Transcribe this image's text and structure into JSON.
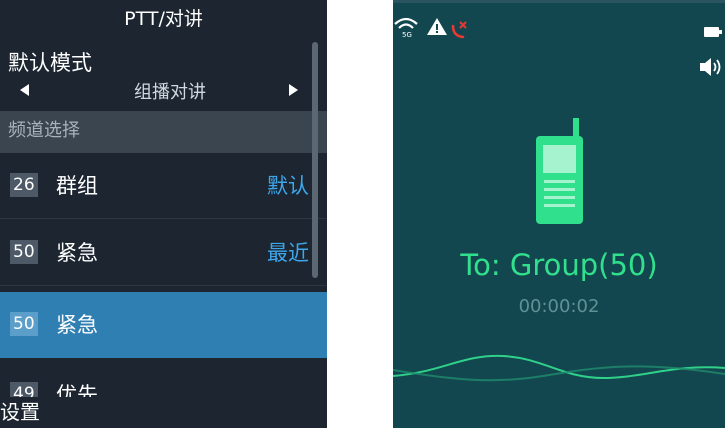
{
  "left_screen": {
    "title": "PTT/对讲",
    "mode": {
      "label": "默认模式",
      "value": "组播对讲"
    },
    "section_header": "频道选择",
    "channels": [
      {
        "number": "26",
        "name": "群组",
        "tag": "默认"
      },
      {
        "number": "50",
        "name": "紧急",
        "tag": "最近"
      },
      {
        "number": "50",
        "name": "紧急",
        "tag": ""
      },
      {
        "number": "49",
        "name": "优先",
        "tag": ""
      }
    ],
    "bottom_label": "设置"
  },
  "right_screen": {
    "call_label": "To: Group(50)",
    "timer": "00:00:02",
    "status_icons": [
      "wifi-5g-icon",
      "warning-icon",
      "missed-call-icon",
      "battery-icon",
      "speaker-icon"
    ]
  },
  "colors": {
    "left_bg": "#1c2530",
    "selected_row": "#2f7fb3",
    "tag_blue": "#3ea6ea",
    "right_bg": "#13474f",
    "accent_green": "#31e08c",
    "warning_red": "#e53935"
  }
}
